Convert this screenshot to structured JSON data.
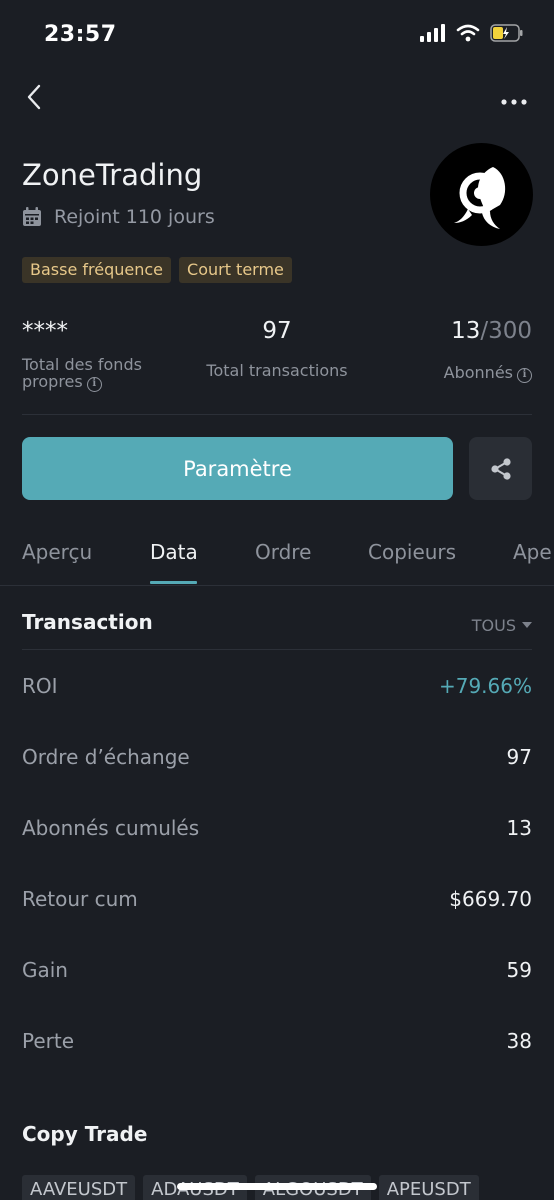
{
  "status_bar": {
    "time": "23:57"
  },
  "profile": {
    "name": "ZoneTrading",
    "joined": "Rejoint 110 jours",
    "tags": [
      "Basse fréquence",
      "Court terme"
    ]
  },
  "stats": {
    "funds": {
      "value": "****",
      "label_line1": "Total des fonds",
      "label_line2": "propres"
    },
    "transactions": {
      "value": "97",
      "label": "Total transactions"
    },
    "subscribers": {
      "current": "13",
      "max": "/300",
      "label": "Abonnés"
    }
  },
  "actions": {
    "param_label": "Paramètre"
  },
  "tabs": [
    {
      "label": "Aperçu"
    },
    {
      "label": "Data"
    },
    {
      "label": "Ordre"
    },
    {
      "label": "Copieurs"
    },
    {
      "label": "Ape"
    }
  ],
  "transaction": {
    "title": "Transaction",
    "filter": "TOUS",
    "rows": [
      {
        "label": "ROI",
        "value": "+79.66%"
      },
      {
        "label": "Ordre d’échange",
        "value": "97"
      },
      {
        "label": "Abonnés cumulés",
        "value": "13"
      },
      {
        "label": "Retour cum",
        "value": "$669.70"
      },
      {
        "label": "Gain",
        "value": "59"
      },
      {
        "label": "Perte",
        "value": "38"
      }
    ]
  },
  "copy_trade": {
    "title": "Copy Trade",
    "symbols": [
      "AAVEUSDT",
      "ADAUSDT",
      "ALGOUSDT",
      "APEUSDT"
    ]
  },
  "colors": {
    "accent": "#55aab6",
    "background": "#1b1e24",
    "tag_bg": "#3a3427",
    "tag_text": "#e7c88a"
  },
  "icons": [
    "back-icon",
    "more-icon",
    "calendar-icon",
    "rocket-logo-icon",
    "info-icon",
    "share-icon",
    "caret-down-icon",
    "signal-icon",
    "wifi-icon",
    "battery-icon"
  ]
}
